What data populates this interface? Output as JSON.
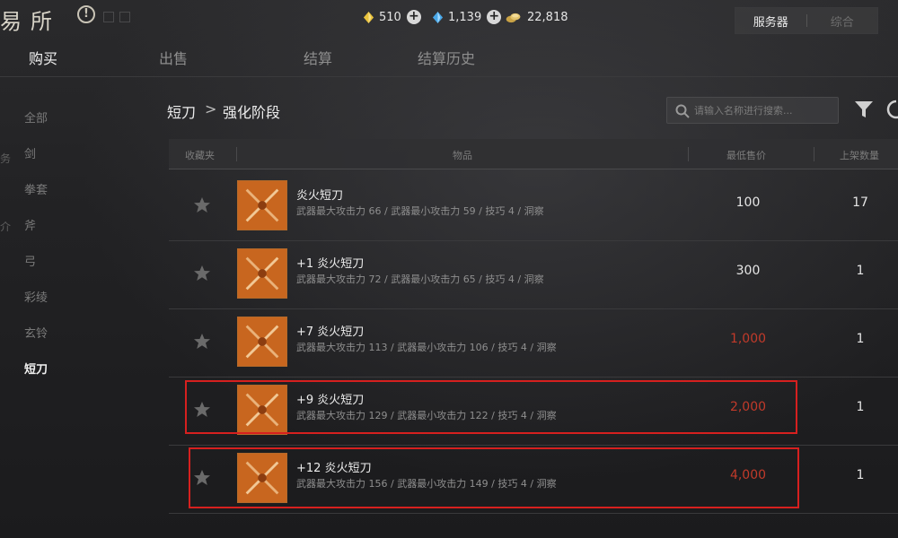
{
  "header": {
    "title_fragment": "易所",
    "currencies": [
      {
        "icon": "gold-crystal-icon",
        "value": "510"
      },
      {
        "icon": "blue-crystal-icon",
        "value": "1,139"
      },
      {
        "icon": "gold-coins-icon",
        "value": "22,818"
      }
    ],
    "server_tabs": [
      {
        "label": "服务器",
        "active": true
      },
      {
        "label": "综合",
        "active": false
      }
    ]
  },
  "nav": {
    "tabs": [
      {
        "label": "购买",
        "active": true
      },
      {
        "label": "出售",
        "active": false
      },
      {
        "label": "结算",
        "active": false
      },
      {
        "label": "结算历史",
        "active": false
      }
    ]
  },
  "sidebar": {
    "categories": [
      {
        "label": "全部",
        "active": false
      },
      {
        "label": "剑",
        "active": false
      },
      {
        "label": "拳套",
        "active": false
      },
      {
        "label": "斧",
        "active": false
      },
      {
        "label": "弓",
        "active": false
      },
      {
        "label": "彩绫",
        "active": false
      },
      {
        "label": "玄铃",
        "active": false
      },
      {
        "label": "短刀",
        "active": true
      }
    ],
    "edge_fragments": [
      "务",
      "介"
    ]
  },
  "breadcrumb": {
    "parent": "短刀",
    "separator": ">",
    "current": "强化阶段"
  },
  "search": {
    "placeholder": "请输入名称进行搜索..."
  },
  "table": {
    "headers": {
      "favorite": "收藏夹",
      "item": "物品",
      "lowest_price": "最低售价",
      "quantity": "上架数量"
    },
    "rows": [
      {
        "name": "炎火短刀",
        "stats": "武器最大攻击力 66  / 武器最小攻击力 59  / 技巧 4  / 洞察",
        "price": "100",
        "price_red": false,
        "quantity": "17",
        "highlighted": false
      },
      {
        "name": "+1 炎火短刀",
        "stats": "武器最大攻击力 72  / 武器最小攻击力 65  / 技巧 4  / 洞察",
        "price": "300",
        "price_red": false,
        "quantity": "1",
        "highlighted": false
      },
      {
        "name": "+7 炎火短刀",
        "stats": "武器最大攻击力 113  / 武器最小攻击力 106  / 技巧 4  / 洞察",
        "price": "1,000",
        "price_red": true,
        "quantity": "1",
        "highlighted": false
      },
      {
        "name": "+9 炎火短刀",
        "stats": "武器最大攻击力 129  / 武器最小攻击力 122  / 技巧 4  / 洞察",
        "price": "2,000",
        "price_red": true,
        "quantity": "1",
        "highlighted": true
      },
      {
        "name": "+12 炎火短刀",
        "stats": "武器最大攻击力 156  / 武器最小攻击力 149  / 技巧 4  / 洞察",
        "price": "4,000",
        "price_red": true,
        "quantity": "1",
        "highlighted": true
      }
    ]
  },
  "colors": {
    "price_red": "#c23a2a",
    "highlight_red": "#d6201f",
    "item_orange": "#c8661f"
  }
}
